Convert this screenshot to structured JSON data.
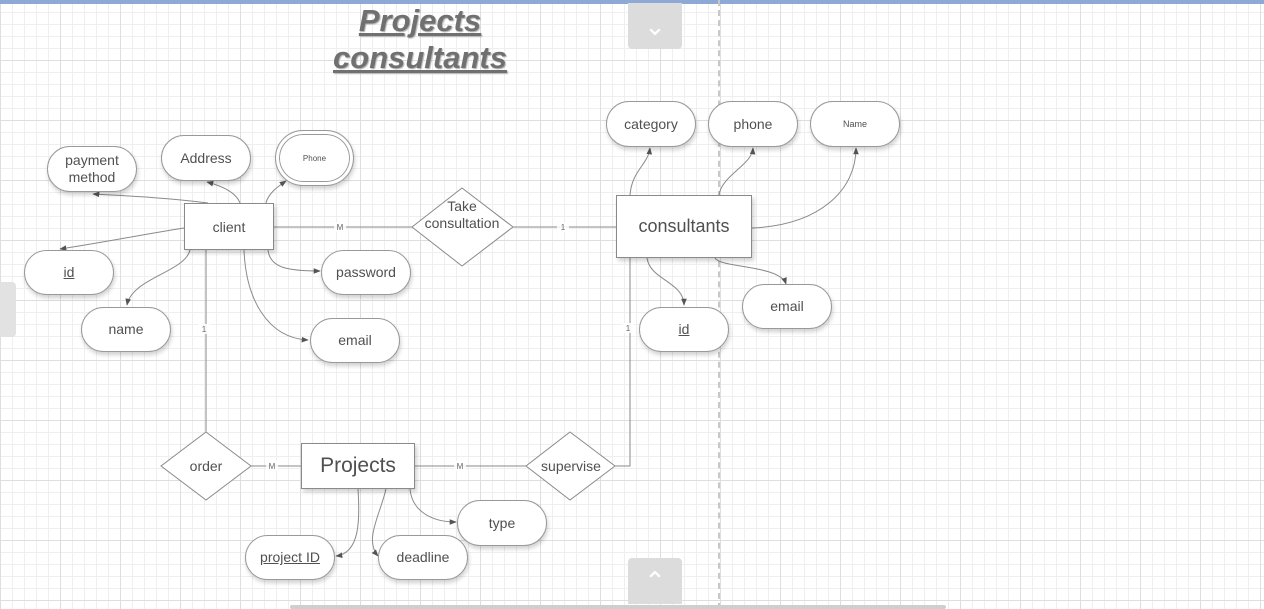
{
  "title": {
    "line1": "Projects",
    "line2": "consultants"
  },
  "nav": {
    "up": "⌄",
    "down": "⌃"
  },
  "entities": {
    "client": "client",
    "consultants": "consultants",
    "projects": "Projects"
  },
  "relationships": {
    "take_consultation": "Take consultation",
    "order": "order",
    "supervise": "supervise"
  },
  "attributes": {
    "payment_method": "payment method",
    "address": "Address",
    "phone_client": "Phone",
    "client_id": "id",
    "client_name": "name",
    "password": "password",
    "client_email": "email",
    "category": "category",
    "phone": "phone",
    "consultant_name": "Name",
    "consultant_id": "id",
    "consultant_email": "email",
    "type": "type",
    "project_id": "project ID",
    "deadline": "deadline"
  },
  "multiplicities": {
    "client_take": "M",
    "take_consultants": "1",
    "client_order": "1",
    "order_projects": "M",
    "projects_supervise": "M",
    "consultants_supervise": "1"
  }
}
